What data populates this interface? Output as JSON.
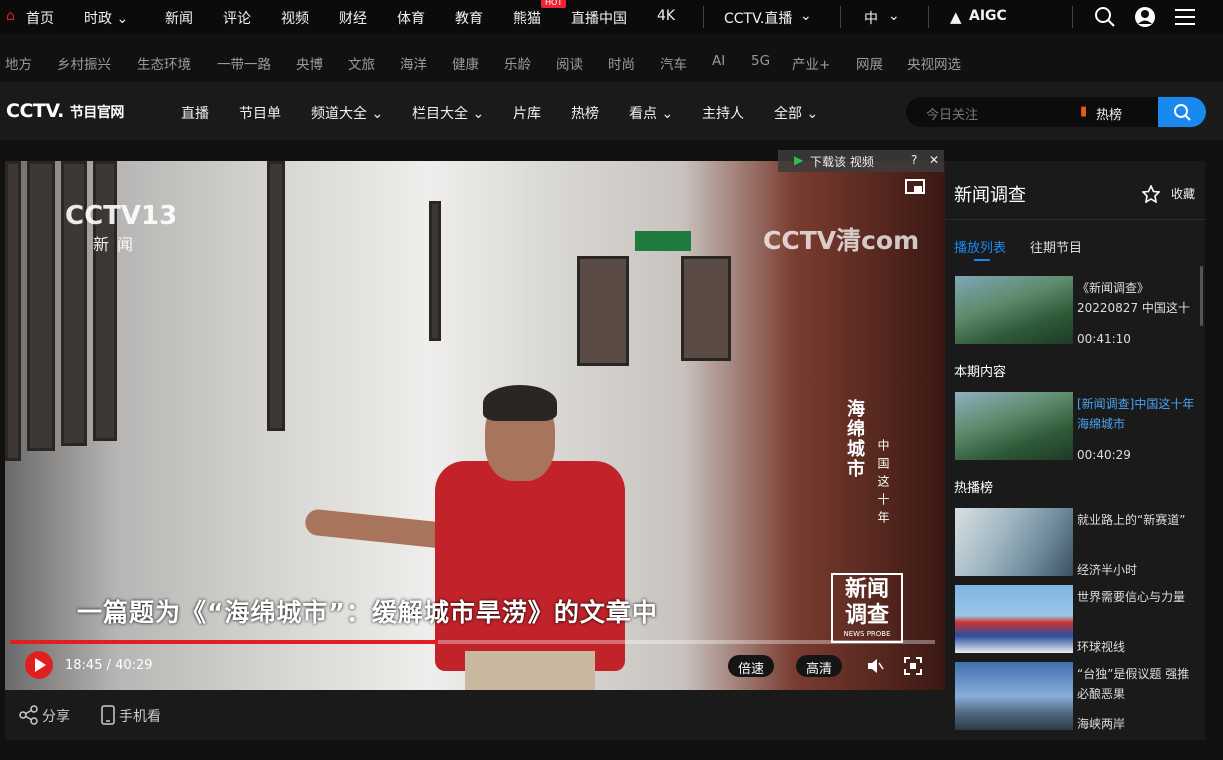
{
  "topnav": {
    "items": [
      "首页",
      "时政 ⌄",
      "新闻",
      "评论",
      "视频",
      "财经",
      "体育",
      "教育",
      "熊猫",
      "直播中国",
      "4K",
      "CCTV.直播",
      "中",
      "AIGC"
    ],
    "hot_badge": "HOT"
  },
  "subnav": [
    "地方",
    "乡村振兴",
    "生态环境",
    "一带一路",
    "央博",
    "文旅",
    "海洋",
    "健康",
    "乐龄",
    "阅读",
    "时尚",
    "汽车",
    "AI",
    "5G",
    "产业+",
    "网展",
    "央视网选"
  ],
  "mainbar": {
    "logo": "CCTV.",
    "logo_sub": "节目官网",
    "nav": [
      "直播",
      "节目单",
      "频道大全 ⌄",
      "栏目大全 ⌄",
      "片库",
      "热榜",
      "看点 ⌄",
      "主持人",
      "全部 ⌄"
    ],
    "search_placeholder": "今日关注",
    "hot_label": "热榜"
  },
  "player": {
    "download_label": "下载该 视频",
    "channel_logo": "CCTV13",
    "channel_sub": "新闻",
    "watermark": "CCTV清com",
    "vertical_title": "海绵城市",
    "vertical_subtitle": "中国这十年",
    "caption": "一篇题为《“海绵城市”：缓解城市旱涝》的文章中",
    "program_logo": "新闻调查",
    "program_logo_en": "NEWS PROBE",
    "time": "18:45 / 40:29",
    "progress_fraction": 0.463,
    "speed_label": "倍速",
    "quality_label": "高清"
  },
  "under": {
    "share": "分享",
    "mobile": "手机看"
  },
  "sidebar": {
    "title": "新闻调查",
    "favorite": "收藏",
    "tabs": [
      "播放列表",
      "往期节目"
    ],
    "playlist": [
      {
        "title": "《新闻调查》20220827 中国这十",
        "duration": "00:41:10"
      }
    ],
    "current_label": "本期内容",
    "current": {
      "title": "[新闻调查]中国这十年 海绵城市",
      "duration": "00:40:29"
    },
    "hot_label": "热播榜",
    "hot": [
      {
        "title": "就业路上的“新赛道”",
        "source": "经济半小时"
      },
      {
        "title": "世界需要信心与力量",
        "source": "环球视线"
      },
      {
        "title": "“台独”是假议题 强推必酿恶果",
        "source": "海峡两岸"
      }
    ]
  }
}
